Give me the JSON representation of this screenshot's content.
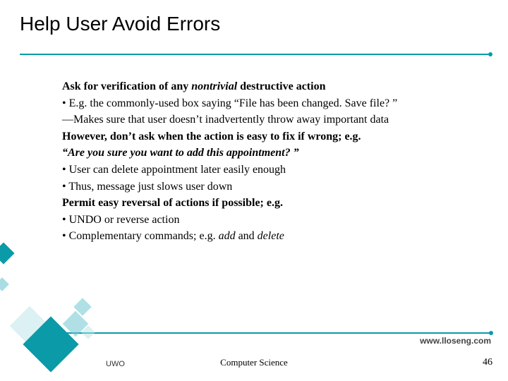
{
  "title": "Help User Avoid Errors",
  "lines": {
    "l1a": "Ask for verification of any ",
    "l1b": "nontrivial",
    "l1c": " destructive action",
    "l2": "E.g. the commonly-used box saying “File has been changed. Save file? ”",
    "l3": "Makes sure that user doesn’t inadvertently throw away important data",
    "l4": "However, don’t ask when the action is easy to fix if wrong; e.g.",
    "l5": "“Are you sure you want to add this appointment? ”",
    "l6": "User can delete appointment later easily enough",
    "l7": "Thus, message just slows user down",
    "l8": "Permit easy reversal of actions if possible; e.g.",
    "l9": "UNDO or reverse action",
    "l10a": "Complementary commands; e.g. ",
    "l10b": "add",
    "l10c": " and ",
    "l10d": "delete"
  },
  "footer": {
    "url": "www.lloseng.com",
    "left": "UWO",
    "mid": "Computer Science",
    "page": "46"
  }
}
